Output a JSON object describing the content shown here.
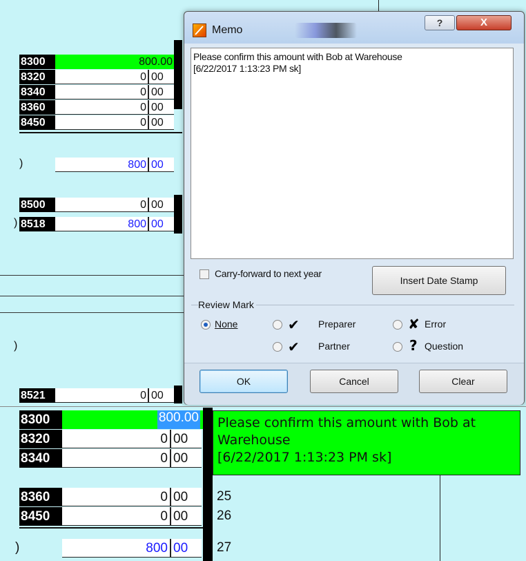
{
  "top_grid": {
    "rows": [
      {
        "code": "8300",
        "amount": "800.00",
        "cents": "",
        "highlight": true
      },
      {
        "code": "8320",
        "amount": "0",
        "cents": "00"
      },
      {
        "code": "8340",
        "amount": "0",
        "cents": "00"
      },
      {
        "code": "8360",
        "amount": "0",
        "cents": "00"
      },
      {
        "code": "8450",
        "amount": "0",
        "cents": "00"
      }
    ],
    "total": {
      "paren": ")",
      "amount": "800",
      "cents": "00"
    },
    "rows2": [
      {
        "code": "8500",
        "amount": "0",
        "cents": "00"
      },
      {
        "code": "8518",
        "amount": "800",
        "cents": "00",
        "paren": ")"
      }
    ],
    "paren3": ")",
    "row_8521": {
      "code": "8521",
      "amount": "0",
      "cents": "00"
    }
  },
  "memo_dialog": {
    "title": "Memo",
    "text_line1": "Please confirm this amount with Bob at Warehouse",
    "text_line2": "[6/22/2017 1:13:23 PM sk]",
    "carry_forward_label": "Carry-forward to next year",
    "insert_date_stamp_label": "Insert Date Stamp",
    "review_mark_label": "Review Mark",
    "review_options": {
      "none": "None",
      "preparer": "Preparer",
      "partner": "Partner",
      "error": "Error",
      "question": "Question"
    },
    "ok_label": "OK",
    "cancel_label": "Cancel",
    "clear_label": "Clear",
    "help_glyph": "?",
    "close_glyph": "X"
  },
  "bottom_grid": {
    "rows": [
      {
        "code": "8300",
        "amount": "800.00",
        "cents": "",
        "selected": true
      },
      {
        "code": "8320",
        "amount": "0",
        "cents": "00"
      },
      {
        "code": "8340",
        "amount": "0",
        "cents": "00"
      },
      {
        "code": "8360",
        "amount": "0",
        "cents": "00",
        "line": "25"
      },
      {
        "code": "8450",
        "amount": "0",
        "cents": "00",
        "line": "26"
      }
    ],
    "total": {
      "paren": ")",
      "amount": "800",
      "cents": "00",
      "line": "27"
    },
    "memo_line1": "Please confirm this amount with Bob at",
    "memo_line2": "Warehouse",
    "memo_line3": "[6/22/2017 1:13:23 PM sk]"
  },
  "colors": {
    "highlight_green": "#00ff00",
    "background": "#c8f4f8",
    "link_blue": "#1a1aff"
  }
}
